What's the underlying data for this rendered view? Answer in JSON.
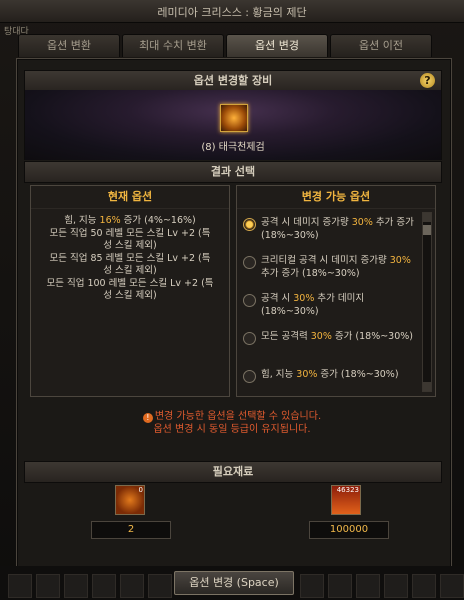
{
  "window": {
    "title": "레미디아 크리스스 : 황금의 제단",
    "corner_label": "탕대다"
  },
  "tabs": [
    {
      "label": "옵션 변환",
      "active": false
    },
    {
      "label": "최대 수치 변환",
      "active": false
    },
    {
      "label": "옵션 변경",
      "active": true
    },
    {
      "label": "옵션 이전",
      "active": false
    }
  ],
  "equip_section": {
    "title": "옵션 변경할 장비",
    "help_label": "?",
    "item_name": "(8) 태극천제검"
  },
  "result_section": {
    "title": "결과 선택"
  },
  "current_options": {
    "title": "현재 옵션",
    "lines": [
      [
        "힘, 지능 ",
        "16%",
        " 증가 (4%~16%)"
      ],
      [
        "모든 직업 50 레벨 모든 스킬 Lv +2 (특",
        "",
        ""
      ],
      [
        "성 스킬 제외)",
        "",
        ""
      ],
      [
        "모든 직업 85 레벨 모든 스킬 Lv +2 (특",
        "",
        ""
      ],
      [
        "성 스킬 제외)",
        "",
        ""
      ],
      [
        "모든 직업 100 레벨 모든 스킬 Lv +2 (특",
        "",
        ""
      ],
      [
        "성 스킬 제외)",
        "",
        ""
      ]
    ]
  },
  "changeable_options": {
    "title": "변경 가능 옵션",
    "items": [
      {
        "pre": "공격 시 데미지 증가량 ",
        "hl": "30%",
        "post": " 추가 증가 (18%~30%)",
        "selected": true
      },
      {
        "pre": "크리티컬 공격 시 데미지 증가량 ",
        "hl": "30%",
        "post": " 추가 증가 (18%~30%)",
        "selected": false
      },
      {
        "pre": "공격 시 ",
        "hl": "30%",
        "post": " 추가 데미지 (18%~30%)",
        "selected": false
      },
      {
        "pre": "모든 공격력 ",
        "hl": "30%",
        "post": " 증가 (18%~30%)",
        "selected": false
      },
      {
        "pre": "힘, 지능 ",
        "hl": "30%",
        "post": " 증가 (18%~30%)",
        "selected": false
      }
    ]
  },
  "notice": {
    "line1": "변경 가능한 옵션을 선택할 수 있습니다.",
    "line2": "옵션 변경 시 동일 등급이 유지됩니다."
  },
  "materials": {
    "title": "필요재료",
    "items": [
      {
        "icon": "material-ore-icon",
        "badge": "0",
        "quantity": "2"
      },
      {
        "icon": "gold-pile-icon",
        "badge": "46323",
        "quantity": "100000"
      }
    ]
  },
  "actions": {
    "confirm_label": "옵션 변경 (Space)"
  },
  "colors": {
    "highlight": "#f3b43f",
    "notice": "#e05b2f",
    "accent_gold": "#f0b540"
  }
}
